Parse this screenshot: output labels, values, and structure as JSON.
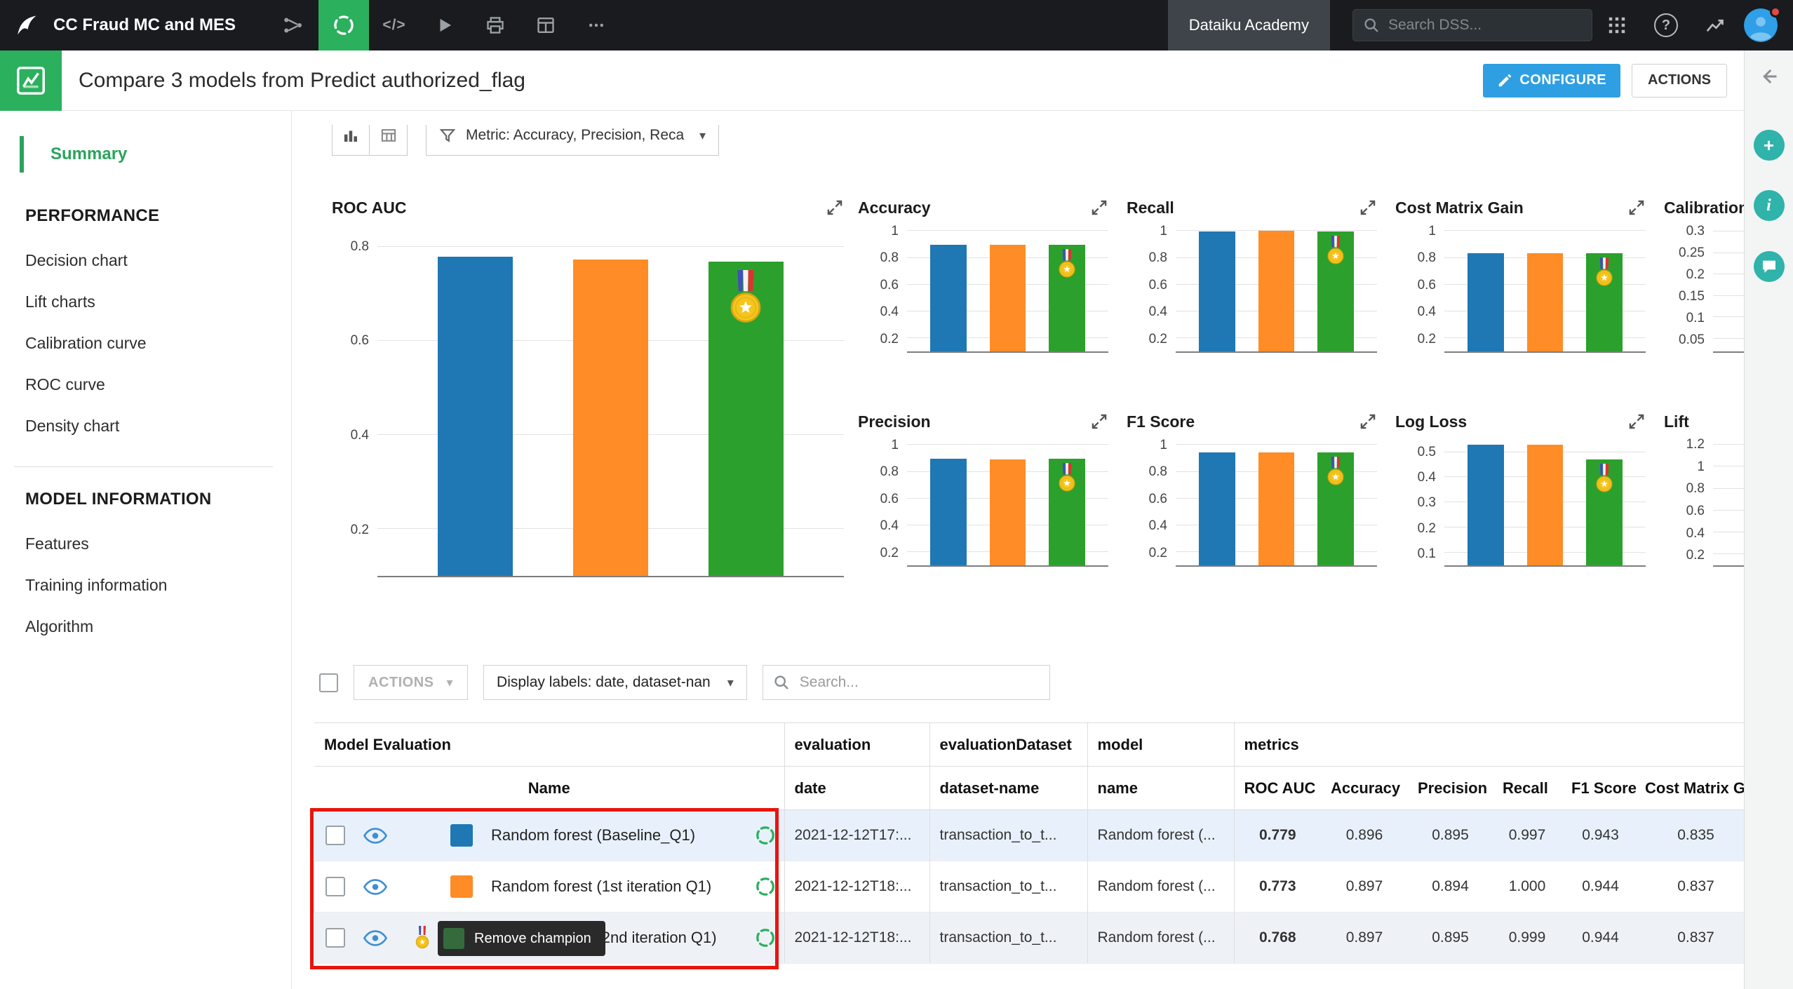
{
  "navbar": {
    "project_title": "CC Fraud MC and MES",
    "academy_label": "Dataiku Academy",
    "search_placeholder": "Search DSS...",
    "icons": [
      "dataiku-logo",
      "flow-icon",
      "visual-analysis-icon",
      "code-icon",
      "play-icon",
      "jobs-icon",
      "dashboard-icon",
      "more-icon",
      "apps-grid-icon",
      "help-icon",
      "trending-icon",
      "user-avatar"
    ]
  },
  "header": {
    "title": "Compare 3 models from Predict authorized_flag",
    "configure_label": "CONFIGURE",
    "actions_label": "ACTIONS",
    "icon": "model-comparison-icon"
  },
  "right_rail": {
    "icons": [
      "back-arrow-icon",
      "add-icon",
      "info-icon",
      "comment-icon"
    ]
  },
  "sidebar": {
    "summary_label": "Summary",
    "sections": [
      {
        "title": "PERFORMANCE",
        "items": [
          "Decision chart",
          "Lift charts",
          "Calibration curve",
          "ROC curve",
          "Density chart"
        ]
      },
      {
        "title": "MODEL INFORMATION",
        "items": [
          "Features",
          "Training information",
          "Algorithm"
        ]
      }
    ]
  },
  "toolbar": {
    "metric_dropdown": "Metric: Accuracy, Precision, Reca",
    "icons": [
      "bar-chart-view-icon",
      "table-view-icon",
      "filter-icon"
    ]
  },
  "controls": {
    "actions_label": "ACTIONS",
    "display_labels_label": "Display labels: date, dataset-nan",
    "search_placeholder": "Search..."
  },
  "tooltip_text": "Remove champion",
  "colors": {
    "accent_green": "#2bb05d",
    "accent_blue": "#2e9fe2",
    "teal": "#2fb3aa",
    "highlight_red": "#e8150e",
    "bars": [
      "#1f77b4",
      "#ff8c26",
      "#2ca02c"
    ]
  },
  "chart_data": [
    {
      "id": "roc-auc",
      "type": "bar",
      "size": "large",
      "title": "ROC AUC",
      "categories": [
        "Random forest (Baseline_Q1)",
        "Random forest (1st iteration Q1)",
        "Random forest (2nd iteration Q1)"
      ],
      "values": [
        0.779,
        0.773,
        0.768
      ],
      "ylim": [
        0.1,
        0.85
      ],
      "ticks": [
        "0.2",
        "0.4",
        "0.6",
        "0.8"
      ],
      "champion_index": 2
    },
    {
      "id": "accuracy",
      "type": "bar",
      "title": "Accuracy",
      "categories": [
        "Random forest (Baseline_Q1)",
        "Random forest (1st iteration Q1)",
        "Random forest (2nd iteration Q1)"
      ],
      "values": [
        0.896,
        0.897,
        0.897
      ],
      "ylim": [
        0.1,
        1.06
      ],
      "ticks": [
        "0.2",
        "0.4",
        "0.6",
        "0.8",
        "1"
      ],
      "champion_index": 2
    },
    {
      "id": "recall",
      "type": "bar",
      "title": "Recall",
      "categories": [
        "Random forest (Baseline_Q1)",
        "Random forest (1st iteration Q1)",
        "Random forest (2nd iteration Q1)"
      ],
      "values": [
        0.997,
        1.0,
        0.999
      ],
      "ylim": [
        0.1,
        1.06
      ],
      "ticks": [
        "0.2",
        "0.4",
        "0.6",
        "0.8",
        "1"
      ],
      "champion_index": 2
    },
    {
      "id": "cost-matrix-gain",
      "type": "bar",
      "title": "Cost Matrix Gain",
      "categories": [
        "Random forest (Baseline_Q1)",
        "Random forest (1st iteration Q1)",
        "Random forest (2nd iteration Q1)"
      ],
      "values": [
        0.835,
        0.837,
        0.837
      ],
      "ylim": [
        0.1,
        1.06
      ],
      "ticks": [
        "0.2",
        "0.4",
        "0.6",
        "0.8",
        "1"
      ],
      "champion_index": 2
    },
    {
      "id": "calibration",
      "type": "bar",
      "title": "Calibration",
      "clipped": true,
      "categories": [
        "Random forest (Baseline_Q1)",
        "Random forest (1st iteration Q1)",
        "Random forest (2nd iteration Q1)"
      ],
      "values": [],
      "ylim": [
        0.02,
        0.32
      ],
      "ticks": [
        "0.05",
        "0.1",
        "0.15",
        "0.2",
        "0.25",
        "0.3"
      ],
      "champion_index": null
    },
    {
      "id": "precision",
      "type": "bar",
      "title": "Precision",
      "categories": [
        "Random forest (Baseline_Q1)",
        "Random forest (1st iteration Q1)",
        "Random forest (2nd iteration Q1)"
      ],
      "values": [
        0.895,
        0.894,
        0.895
      ],
      "ylim": [
        0.1,
        1.06
      ],
      "ticks": [
        "0.2",
        "0.4",
        "0.6",
        "0.8",
        "1"
      ],
      "champion_index": 2
    },
    {
      "id": "f1-score",
      "type": "bar",
      "title": "F1 Score",
      "categories": [
        "Random forest (Baseline_Q1)",
        "Random forest (1st iteration Q1)",
        "Random forest (2nd iteration Q1)"
      ],
      "values": [
        0.943,
        0.944,
        0.944
      ],
      "ylim": [
        0.1,
        1.06
      ],
      "ticks": [
        "0.2",
        "0.4",
        "0.6",
        "0.8",
        "1"
      ],
      "champion_index": 2
    },
    {
      "id": "log-loss",
      "type": "bar",
      "title": "Log Loss",
      "categories": [
        "Random forest (Baseline_Q1)",
        "Random forest (1st iteration Q1)",
        "Random forest (2nd iteration Q1)"
      ],
      "values": [
        0.53,
        0.53,
        0.47
      ],
      "ylim": [
        0.05,
        0.56
      ],
      "ticks": [
        "0.1",
        "0.2",
        "0.3",
        "0.4",
        "0.5"
      ],
      "champion_index": 2
    },
    {
      "id": "lift",
      "type": "bar",
      "title": "Lift",
      "clipped": true,
      "categories": [
        "Random forest (Baseline_Q1)",
        "Random forest (1st iteration Q1)",
        "Random forest (2nd iteration Q1)"
      ],
      "values": [],
      "ylim": [
        0.1,
        1.27
      ],
      "ticks": [
        "0.2",
        "0.4",
        "0.6",
        "0.8",
        "1",
        "1.2"
      ],
      "champion_index": null
    }
  ],
  "table": {
    "group_headers": [
      "Model Evaluation",
      "evaluation",
      "evaluationDataset",
      "model",
      "metrics"
    ],
    "sub_headers": {
      "name": "Name",
      "date": "date",
      "dataset": "dataset-name",
      "model": "name",
      "metrics": [
        "ROC AUC",
        "Accuracy",
        "Precision",
        "Recall",
        "F1 Score",
        "Cost Matrix Gain"
      ]
    },
    "rows": [
      {
        "name": "Random forest (Baseline_Q1)",
        "swatch": "#1f77b4",
        "champion": false,
        "date": "2021-12-12T17:...",
        "dataset": "transaction_to_t...",
        "model": "Random forest (...",
        "metrics": [
          "0.779",
          "0.896",
          "0.895",
          "0.997",
          "0.943",
          "0.835"
        ]
      },
      {
        "name": "Random forest (1st iteration Q1)",
        "swatch": "#ff8c26",
        "champion": false,
        "date": "2021-12-12T18:...",
        "dataset": "transaction_to_t...",
        "model": "Random forest (...",
        "metrics": [
          "0.773",
          "0.897",
          "0.894",
          "1.000",
          "0.944",
          "0.837"
        ]
      },
      {
        "name": "Random forest (2nd iteration Q1)",
        "swatch": "#2ca02c",
        "champion": true,
        "date": "2021-12-12T18:...",
        "dataset": "transaction_to_t...",
        "model": "Random forest (...",
        "metrics": [
          "0.768",
          "0.897",
          "0.895",
          "0.999",
          "0.944",
          "0.837"
        ]
      }
    ]
  }
}
